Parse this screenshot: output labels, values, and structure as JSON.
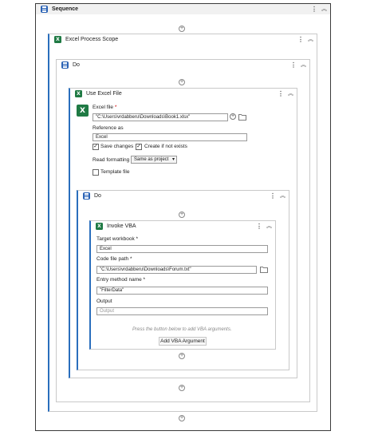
{
  "sequence": {
    "title": "Sequence"
  },
  "process_scope": {
    "title": "Excel Process Scope"
  },
  "do_outer": {
    "title": "Do"
  },
  "use_excel": {
    "title": "Use Excel File",
    "excel_file_label": "Excel file",
    "excel_file_value": "\"C:\\Users\\vrdabberu\\Downloads\\Book1.xlsx\"",
    "reference_label": "Reference as",
    "reference_value": "Excel",
    "save_changes_label": "Save changes",
    "create_if_not_exists_label": "Create if not exists",
    "read_formatting_label": "Read formatting",
    "read_formatting_value": "Same as project",
    "template_file_label": "Template file"
  },
  "do_inner": {
    "title": "Do"
  },
  "invoke_vba": {
    "title": "Invoke VBA",
    "target_workbook_label": "Target workbook",
    "target_workbook_value": "Excel",
    "code_file_label": "Code file path",
    "code_file_value": "\"C:\\Users\\vrdabberu\\Downloads\\Forum.txt\"",
    "entry_method_label": "Entry method name",
    "entry_method_value": "\"FilterData\"",
    "output_label": "Output",
    "output_placeholder": "Output",
    "hint": "Press the button below to add VBA arguments.",
    "add_arg_button": "Add VBA Argument"
  },
  "icons": {
    "kebab": "⋮",
    "collapse": "︽",
    "plus": "+",
    "excel_letter": "X",
    "check": "✓",
    "chevron": "▾",
    "required": "*"
  },
  "colors": {
    "accent": "#2a6ebd",
    "excel_green": "#1f7a44"
  }
}
